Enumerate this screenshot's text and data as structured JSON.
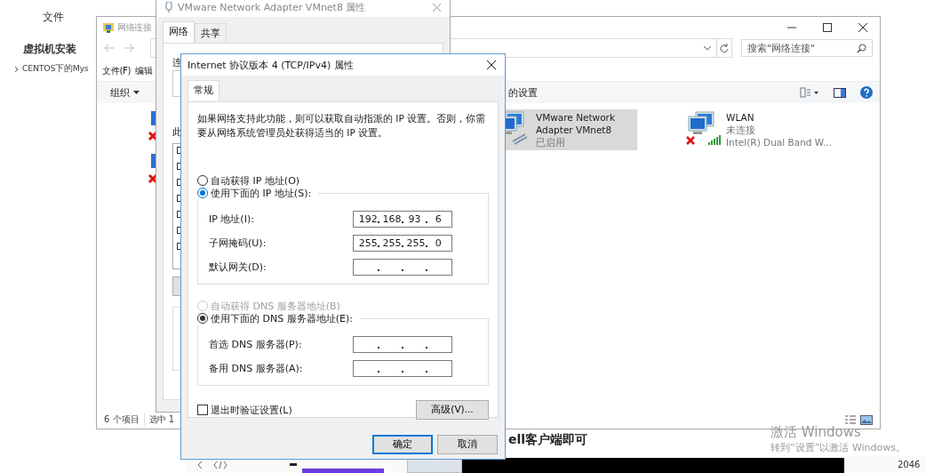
{
  "background_page": {
    "menu_label": "文件",
    "heading": "虚拟机安装",
    "tree_item": "CENTOS下的Mys",
    "bottom_heading": "ell客户端即可",
    "word_count": "2046"
  },
  "network_window": {
    "title": "网络连接",
    "search_placeholder": "搜索\"网络连接\"",
    "menu": [
      "文件(F)",
      "编辑"
    ],
    "toolbar": [
      "组织",
      "的设置"
    ],
    "items": [
      {
        "kind": "wired",
        "name": "VMware Network Adapter VMnet8",
        "status": "已启用",
        "selected": true,
        "disconnected": false
      },
      {
        "kind": "wireless",
        "name": "WLAN",
        "status": "未连接",
        "device": "Intel(R) Dual Band W...",
        "selected": false,
        "disconnected": true
      }
    ],
    "status_bar": [
      "6 个项目",
      "选中 1"
    ]
  },
  "adapter_dialog": {
    "title": "VMware Network Adapter VMnet8 属性",
    "tabs": [
      {
        "label": "网络",
        "selected": true
      },
      {
        "label": "共享",
        "selected": false
      }
    ],
    "labels": [
      "连",
      "此"
    ]
  },
  "ipv4_dialog": {
    "title": "Internet 协议版本 4 (TCP/IPv4) 属性",
    "tabs": [
      {
        "label": "常规",
        "selected": true
      }
    ],
    "intro": "如果网络支持此功能，则可以获取自动指派的 IP 设置。否则，你需要从网络系统管理员处获得适当的 IP 设置。",
    "groups": [
      {
        "auto": {
          "label": "自动获得 IP 地址(O)",
          "selected": false,
          "disabled": false
        },
        "manual": {
          "label": "使用下面的 IP 地址(S):",
          "selected": true,
          "disabled": false
        },
        "fields": [
          {
            "label": "IP 地址(I):",
            "octets": [
              "192",
              "168",
              "93",
              "6"
            ]
          },
          {
            "label": "子网掩码(U):",
            "octets": [
              "255",
              "255",
              "255",
              "0"
            ]
          },
          {
            "label": "默认网关(D):"
          }
        ]
      },
      {
        "auto": {
          "label": "自动获得 DNS 服务器地址(B)",
          "selected": false,
          "disabled": true
        },
        "manual": {
          "label": "使用下面的 DNS 服务器地址(E):",
          "selected": true,
          "disabled": false
        },
        "fields": [
          {
            "label": "首选 DNS 服务器(P):"
          },
          {
            "label": "备用 DNS 服务器(A):"
          }
        ]
      }
    ],
    "validate": {
      "label": "退出时验证设置(L)",
      "checked": false
    },
    "advanced_button": "高级(V)...",
    "ok_button": "确定",
    "cancel_button": "取消"
  },
  "activation": {
    "title": "激活 Windows",
    "hint": "转到“设置”以激活 Windows。"
  }
}
